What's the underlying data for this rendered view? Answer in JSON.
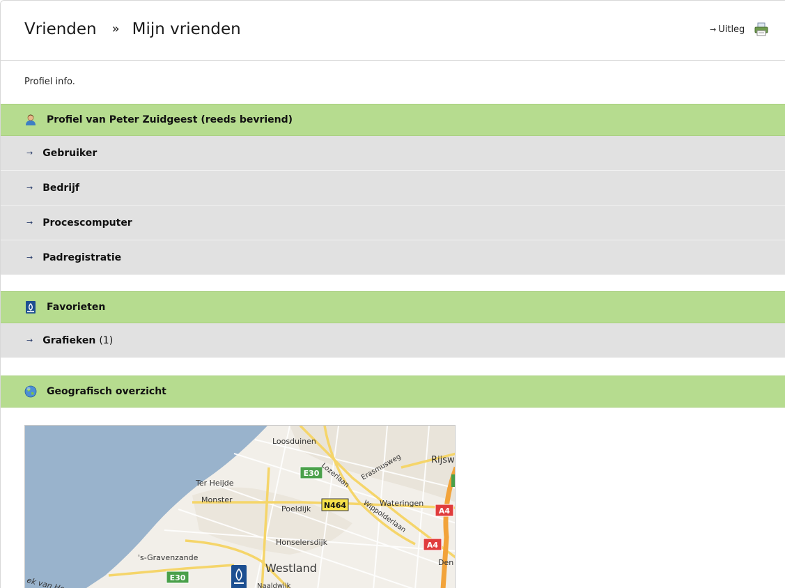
{
  "breadcrumb": {
    "parent": "Vrienden",
    "separator": "»",
    "current": "Mijn vrienden"
  },
  "help": {
    "label": "Uitleg",
    "arrow": "→"
  },
  "intro_text": "Profiel info.",
  "profile_section": {
    "title": "Profiel van Peter Zuidgeest (reeds bevriend)",
    "icon": "user-icon",
    "items": [
      {
        "label": "Gebruiker"
      },
      {
        "label": "Bedrijf"
      },
      {
        "label": "Procescomputer"
      },
      {
        "label": "Padregistratie"
      }
    ]
  },
  "favorites_section": {
    "title": "Favorieten",
    "icon": "priva-logo-icon",
    "items": [
      {
        "label": "Grafieken",
        "count": "(1)"
      }
    ]
  },
  "geo_section": {
    "title": "Geografisch overzicht",
    "icon": "globe-icon"
  },
  "map": {
    "labels": {
      "loosduinen": "Loosduinen",
      "rijswijk": "Rijsw",
      "ter_heijde": "Ter Heijde",
      "monster": "Monster",
      "poeldijk": "Poeldijk",
      "wateringen": "Wateringen",
      "honselersdijk": "Honselersdijk",
      "gravenzande": "'s-Gravenzande",
      "westland": "Westland",
      "naaldwijk": "Naaldwijk",
      "den": "Den",
      "hoek": "ek van Ho",
      "lozerlaan": "Lozerlaan",
      "erasmusweg": "Erasmusweg",
      "wippolderlaan": "Wippolderlaan"
    },
    "shields": {
      "e30_top": "E30",
      "e30_bottom": "E30",
      "n464": "N464",
      "a4_top": "A4",
      "a4_bottom": "A4"
    },
    "colors": {
      "water": "#99b3cc",
      "land": "#f2efe9",
      "road": "#f5d56a",
      "green": "#4aa04a",
      "red": "#e03c3c"
    }
  }
}
